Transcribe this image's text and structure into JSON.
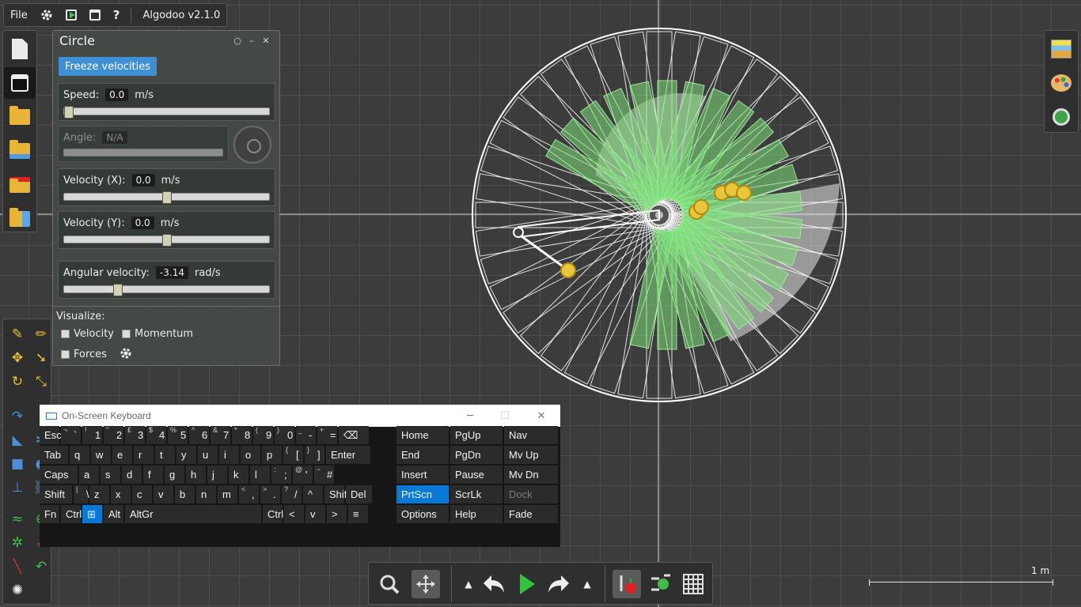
{
  "menu": {
    "file_label": "File",
    "app_title": "Algodoo v2.1.0"
  },
  "panel": {
    "title": "Circle",
    "freeze_label": "Freeze velocities",
    "speed": {
      "label": "Speed:",
      "value": "0.0",
      "unit": "m/s",
      "slider_level": 0.0
    },
    "angle": {
      "label": "Angle:",
      "value": "N/A"
    },
    "velocity_x": {
      "label": "Velocity (X):",
      "value": "0.0",
      "unit": "m/s",
      "slider_level": 0.5
    },
    "velocity_y": {
      "label": "Velocity (Y):",
      "value": "0.0",
      "unit": "m/s",
      "slider_level": 0.5
    },
    "angular": {
      "label": "Angular velocity:",
      "value": "-3.14",
      "unit": "rad/s",
      "slider_level": 0.25
    },
    "visualize": {
      "label": "Visualize:",
      "velocity": "Velocity",
      "momentum": "Momentum",
      "forces": "Forces"
    }
  },
  "keyboard": {
    "title": "On-Screen Keyboard",
    "rows": [
      [
        [
          "Esc",
          ""
        ],
        [
          "¬",
          "`"
        ],
        [
          "!",
          "1"
        ],
        [
          "\"",
          "2"
        ],
        [
          "£",
          "3"
        ],
        [
          "$",
          "4"
        ],
        [
          "%",
          "5"
        ],
        [
          "^",
          "6"
        ],
        [
          "&",
          "7"
        ],
        [
          "*",
          "8"
        ],
        [
          "(",
          "9"
        ],
        [
          ")",
          "0"
        ],
        [
          "_",
          "-"
        ],
        [
          "+",
          "="
        ],
        [
          "⌫",
          ""
        ]
      ],
      [
        [
          "Tab",
          ""
        ],
        [
          "q",
          ""
        ],
        [
          "w",
          ""
        ],
        [
          "e",
          ""
        ],
        [
          "r",
          ""
        ],
        [
          "t",
          ""
        ],
        [
          "y",
          ""
        ],
        [
          "u",
          ""
        ],
        [
          "i",
          ""
        ],
        [
          "o",
          ""
        ],
        [
          "p",
          ""
        ],
        [
          "{",
          "["
        ],
        [
          "}",
          "]"
        ],
        [
          "Enter",
          ""
        ]
      ],
      [
        [
          "Caps",
          ""
        ],
        [
          "a",
          ""
        ],
        [
          "s",
          ""
        ],
        [
          "d",
          ""
        ],
        [
          "f",
          ""
        ],
        [
          "g",
          ""
        ],
        [
          "h",
          ""
        ],
        [
          "j",
          ""
        ],
        [
          "k",
          ""
        ],
        [
          "l",
          ""
        ],
        [
          ":",
          ";"
        ],
        [
          "@",
          "'"
        ],
        [
          "~",
          "#"
        ]
      ],
      [
        [
          "Shift",
          ""
        ],
        [
          "|",
          "\\"
        ],
        [
          "z",
          ""
        ],
        [
          "x",
          ""
        ],
        [
          "c",
          ""
        ],
        [
          "v",
          ""
        ],
        [
          "b",
          ""
        ],
        [
          "n",
          ""
        ],
        [
          "m",
          ""
        ],
        [
          "<",
          ","
        ],
        [
          ">",
          "."
        ],
        [
          "?",
          "/"
        ],
        [
          "^",
          ""
        ],
        [
          "Shift",
          ""
        ],
        [
          "Del",
          ""
        ]
      ],
      [
        [
          "Fn",
          ""
        ],
        [
          "Ctrl",
          ""
        ],
        [
          "⊞",
          ""
        ],
        [
          "Alt",
          ""
        ],
        [
          "AltGr",
          ""
        ],
        [
          "Ctrl",
          ""
        ],
        [
          "<",
          ""
        ],
        [
          "v",
          ""
        ],
        [
          ">",
          ""
        ],
        [
          "≡",
          ""
        ]
      ]
    ],
    "nav_keys": [
      [
        "Home",
        "PgUp",
        "Nav"
      ],
      [
        "End",
        "PgDn",
        "Mv Up"
      ],
      [
        "Insert",
        "Pause",
        "Mv Dn"
      ],
      [
        "PrtScn",
        "ScrLk",
        "Dock"
      ],
      [
        "Options",
        "Help",
        "Fade"
      ]
    ]
  },
  "scale_label": "1 m",
  "colors": {
    "accent": "#3f8fd4",
    "green_body": "#7ee07a",
    "play": "#2fc43a",
    "keyboard_selected": "#0a78d7"
  },
  "icons": {
    "settings": "gear-icon",
    "play_scene": "play-icon",
    "window": "window-icon",
    "help": "question-icon",
    "undo": "undo-icon",
    "redo": "redo-icon",
    "zoom": "zoom-icon",
    "move": "move-icon"
  }
}
